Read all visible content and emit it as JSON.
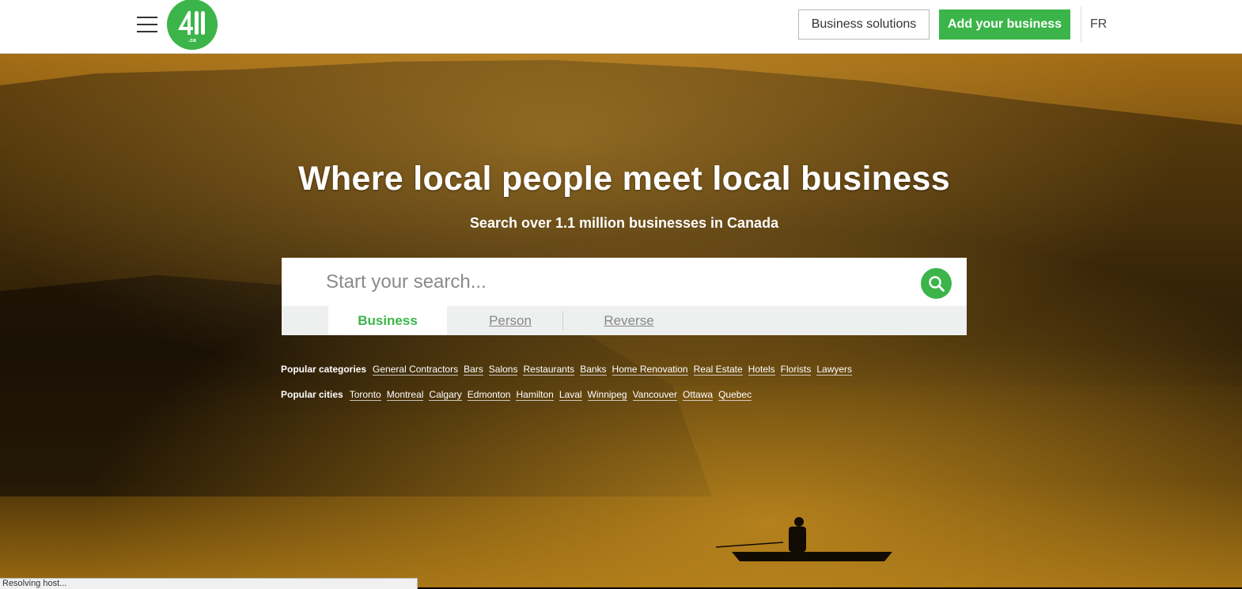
{
  "header": {
    "menu_icon": "hamburger-menu-icon",
    "logo_icon": "411-logo-icon",
    "logo_alt": "411",
    "business_solutions_label": "Business solutions",
    "add_business_label": "Add your business",
    "language_label": "FR"
  },
  "colors": {
    "brand_green": "#3bb54a",
    "tab_inactive": "#888888",
    "tabs_bg": "#eef0ef"
  },
  "hero": {
    "headline": "Where local people meet local business",
    "subline": "Search over 1.1 million businesses in Canada",
    "background_icon": "misty-lake-fisherman-photo"
  },
  "search": {
    "placeholder": "Start your search...",
    "value": "",
    "search_icon": "search-icon",
    "tabs": [
      {
        "label": "Business",
        "active": true
      },
      {
        "label": "Person",
        "active": false
      },
      {
        "label": "Reverse",
        "active": false
      }
    ]
  },
  "popular": {
    "categories_label": "Popular categories",
    "categories": [
      "General Contractors",
      "Bars",
      "Salons",
      "Restaurants",
      "Banks",
      "Home Renovation",
      "Real Estate",
      "Hotels",
      "Florists",
      "Lawyers"
    ],
    "cities_label": "Popular cities",
    "cities": [
      "Toronto",
      "Montreal",
      "Calgary",
      "Edmonton",
      "Hamilton",
      "Laval",
      "Winnipeg",
      "Vancouver",
      "Ottawa",
      "Quebec"
    ]
  },
  "status_bar": {
    "text": "Resolving host..."
  }
}
